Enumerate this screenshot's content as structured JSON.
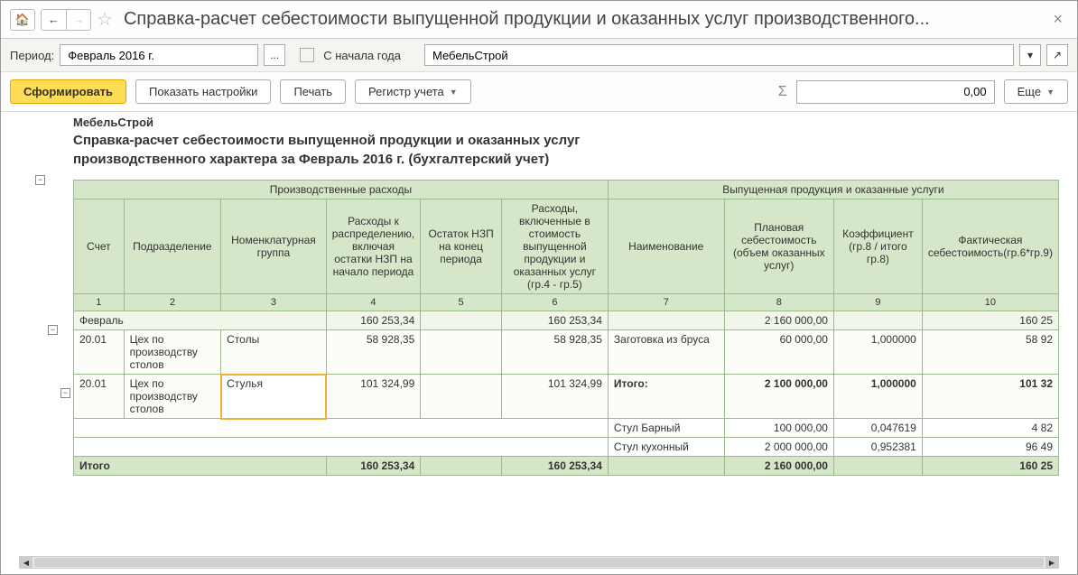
{
  "title": "Справка-расчет себестоимости выпущенной продукции и оказанных услуг производственного...",
  "filter": {
    "period_label": "Период:",
    "period_value": "Февраль 2016 г.",
    "since_label": "С начала года",
    "org_value": "МебельСтрой"
  },
  "toolbar": {
    "form_btn": "Сформировать",
    "show_settings_btn": "Показать настройки",
    "print_btn": "Печать",
    "register_btn": "Регистр учета",
    "sum_value": "0,00",
    "more_btn": "Еще"
  },
  "report": {
    "org": "МебельСтрой",
    "title": "Справка-расчет себестоимости выпущенной продукции и оказанных услуг производственного характера  за Февраль 2016 г. (бухгалтерский учет)",
    "header_groups": {
      "g1": "Производственные расходы",
      "g2": "Выпущенная  продукция и оказанные услуги"
    },
    "cols": {
      "c1": "Счет",
      "c2": "Подразделение",
      "c3": "Номенклатурная группа",
      "c4": "Расходы к распределению, включая остатки НЗП на начало периода",
      "c5": "Остаток НЗП на конец периода",
      "c6": "Расходы, включенные в стоимость выпущенной продукции и оказанных услуг (гр.4 - гр.5)",
      "c7": "Наименование",
      "c8": "Плановая себестоимость (объем оказанных услуг)",
      "c9": "Коэффициент (гр.8 / итого гр.8)",
      "c10": "Фактическая себестоимость(гр.6*гр.9)"
    },
    "colnums": {
      "n1": "1",
      "n2": "2",
      "n3": "3",
      "n4": "4",
      "n5": "5",
      "n6": "6",
      "n7": "7",
      "n8": "8",
      "n9": "9",
      "n10": "10"
    },
    "rows": {
      "month": {
        "label": "Февраль",
        "v4": "160 253,34",
        "v6": "160 253,34",
        "v8": "2 160 000,00",
        "v10": "160 25"
      },
      "r1": {
        "acct": "20.01",
        "dept": "Цех по производству столов",
        "nom": "Столы",
        "v4": "58 928,35",
        "v6": "58 928,35",
        "name": "Заготовка из бруса",
        "v8": "60 000,00",
        "v9": "1,000000",
        "v10": "58 92"
      },
      "r2": {
        "acct": "20.01",
        "dept": "Цех по производству столов",
        "nom": "Стулья",
        "v4": "101 324,99",
        "v6": "101 324,99",
        "name": "Итого:",
        "v8": "2 100 000,00",
        "v9": "1,000000",
        "v10": "101 32"
      },
      "r3": {
        "name": "Стул Барный",
        "v8": "100 000,00",
        "v9": "0,047619",
        "v10": "4 82"
      },
      "r4": {
        "name": "Стул кухонный",
        "v8": "2 000 000,00",
        "v9": "0,952381",
        "v10": "96 49"
      },
      "total": {
        "label": "Итого",
        "v4": "160 253,34",
        "v6": "160 253,34",
        "v8": "2 160 000,00",
        "v10": "160 25"
      }
    }
  }
}
